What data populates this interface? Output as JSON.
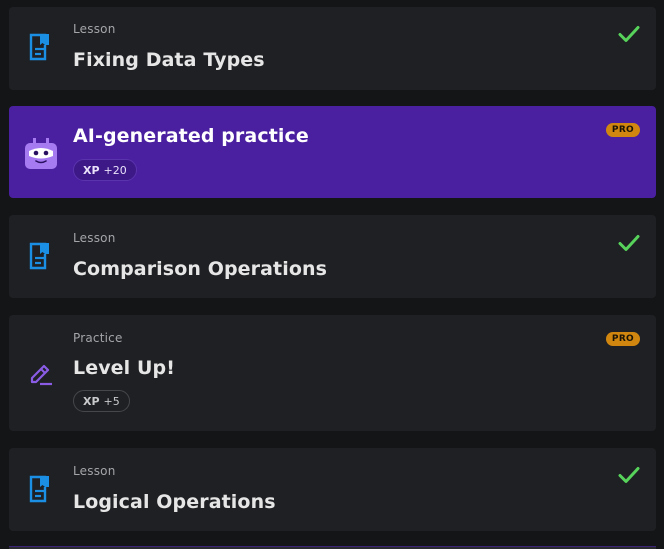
{
  "items": [
    {
      "kind": "Lesson",
      "title": "Fixing Data Types",
      "completed": true,
      "icon": "lesson-document-icon"
    },
    {
      "title": "AI-generated practice",
      "badge": "PRO",
      "xp_label": "XP",
      "xp_value": "+20",
      "icon": "ai-robot-icon"
    },
    {
      "kind": "Lesson",
      "title": "Comparison Operations",
      "completed": true,
      "icon": "lesson-document-icon"
    },
    {
      "kind": "Practice",
      "title": "Level Up!",
      "badge": "PRO",
      "xp_label": "XP",
      "xp_value": "+5",
      "icon": "practice-pencil-icon"
    },
    {
      "kind": "Lesson",
      "title": "Logical Operations",
      "completed": true,
      "icon": "lesson-document-icon"
    }
  ],
  "colors": {
    "background": "#141517",
    "card": "#1f2023",
    "ai_card": "#4a1fa0",
    "check": "#57d35b",
    "pro_badge": "#d1870f",
    "lesson_icon": "#1a8fe3",
    "practice_icon": "#8a5ce6"
  }
}
